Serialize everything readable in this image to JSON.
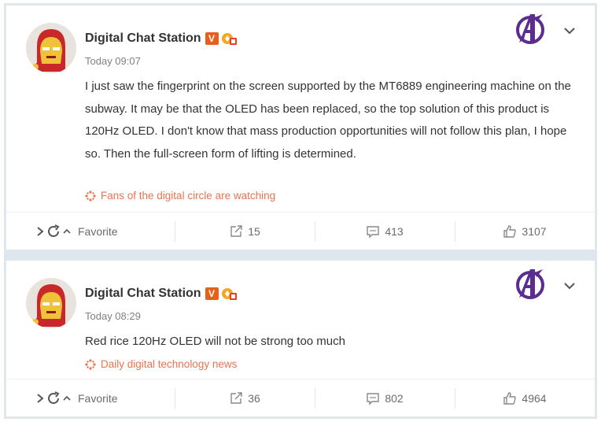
{
  "colors": {
    "accent": "#eb7350",
    "vip": "#e85f1c",
    "divider": "#dfe7ee"
  },
  "posts": [
    {
      "author": "Digital Chat Station",
      "vip_badge": "V",
      "timestamp": "Today 09:07",
      "text": "I just saw the fingerprint on the screen supported by the MT6889 engineering machine on the subway. It may be that the OLED has been replaced, so the top solution of this product is 120Hz OLED. I don't know that mass production opportunities will not follow this plan, I hope so. Then the full-screen form of lifting is determined.",
      "source": "Fans of the digital circle are watching",
      "actions": {
        "favorite_label": "Favorite",
        "reposts": "15",
        "comments": "413",
        "likes": "3107"
      }
    },
    {
      "author": "Digital Chat Station",
      "vip_badge": "V",
      "timestamp": "Today 08:29",
      "text": "Red rice 120Hz OLED will not be strong too much",
      "source": "Daily digital technology news",
      "actions": {
        "favorite_label": "Favorite",
        "reposts": "36",
        "comments": "802",
        "likes": "4964"
      }
    }
  ],
  "icons": [
    "avatar-ironman",
    "vip-badge-icon",
    "medal-icon",
    "avengers-logo-icon",
    "chevron-down-icon",
    "source-icon",
    "chevron-right-icon",
    "refresh-icon",
    "chevron-up-icon",
    "repost-icon",
    "comment-icon",
    "like-icon"
  ]
}
